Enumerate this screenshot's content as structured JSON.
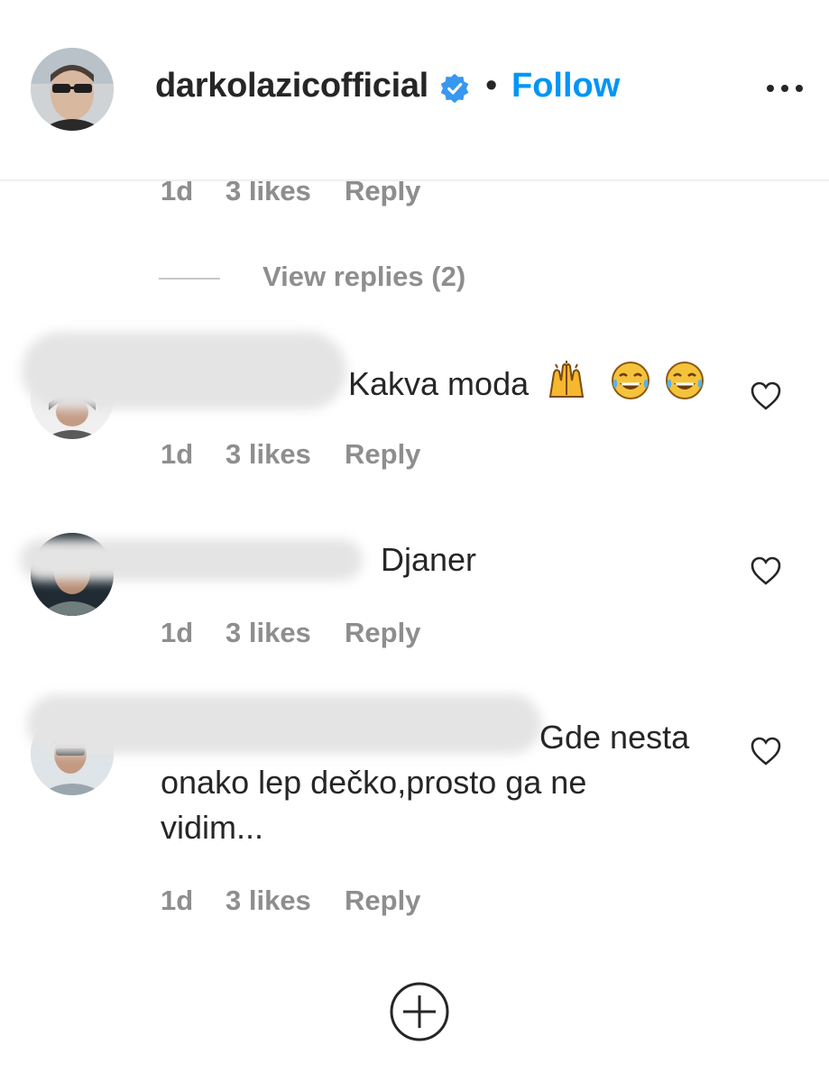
{
  "header": {
    "username": "darkolazicofficial",
    "separator": "•",
    "follow_label": "Follow",
    "more_icon": "more-horizontal-icon",
    "verified_icon": "verified-badge-icon",
    "accent_color": "#0095f6"
  },
  "top_meta": {
    "time": "1d",
    "likes": "3 likes",
    "reply": "Reply"
  },
  "view_replies": "View replies (2)",
  "comments": [
    {
      "text": "Kakva moda",
      "emojis": [
        "raising-hands",
        "tears-of-joy",
        "tears-of-joy"
      ],
      "time": "1d",
      "likes": "3 likes",
      "reply": "Reply"
    },
    {
      "text": "Djaner",
      "time": "1d",
      "likes": "3 likes",
      "reply": "Reply"
    },
    {
      "text_line1": "Gde nesta",
      "text_line2": "onako lep dečko,prosto ga ne",
      "text_line3": "vidim...",
      "time": "1d",
      "likes": "3 likes",
      "reply": "Reply"
    }
  ],
  "load_more_icon": "plus-circle-icon"
}
